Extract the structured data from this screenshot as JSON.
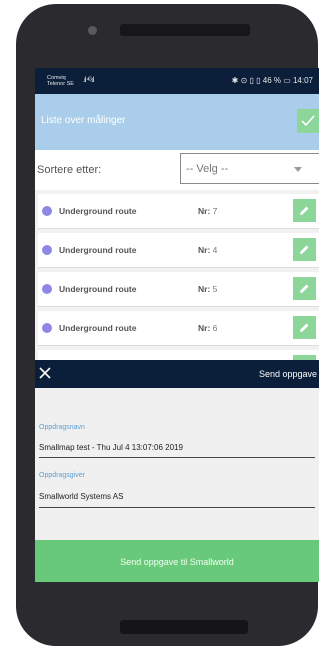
{
  "status_bar": {
    "carrier_line1": "Comviq",
    "carrier_line2": "Telenor SE",
    "signal": ".ıl ⁴ᴳ.ıl",
    "right": "✱ ⊙ ▯ ▯ 46 % ▭ 14:07"
  },
  "app_bar": {
    "title": "Liste over målinger"
  },
  "sort": {
    "label": "Sortere etter:",
    "value": "-- Velg --"
  },
  "list": {
    "nr_label": "Nr:",
    "items": [
      {
        "title": "Underground route",
        "nr": "7"
      },
      {
        "title": "Underground route",
        "nr": "4"
      },
      {
        "title": "Underground route",
        "nr": "5"
      },
      {
        "title": "Underground route",
        "nr": "6"
      }
    ]
  },
  "sheet": {
    "top_send_label": "Send oppgave",
    "field1_label": "Oppdragsnavn",
    "field1_value": "Smallmap test - Thu Jul  4 13:07:06 2019",
    "field2_label": "Oppdragsgiver",
    "field2_value": "Smallworld Systems AS",
    "send_button_label": "Send oppgave til Smallworld"
  },
  "colors": {
    "app_bar": "#a9cdea",
    "accent_green": "#8dd69a",
    "send_green": "#68c97a",
    "navy": "#0b1f3a",
    "dot_purple": "#8f87e6",
    "label_blue": "#5a9ed6"
  }
}
